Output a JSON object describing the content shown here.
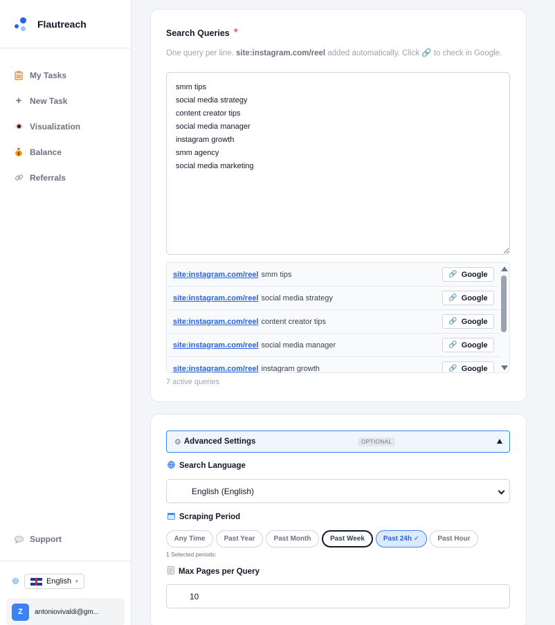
{
  "brand": {
    "name": "Flautreach"
  },
  "sidebar": {
    "items": [
      {
        "label": "My Tasks",
        "icon": "clipboard-icon"
      },
      {
        "label": "New Task",
        "icon": "plus-icon"
      },
      {
        "label": "Visualization",
        "icon": "eye-icon"
      },
      {
        "label": "Balance",
        "icon": "money-bag-icon"
      },
      {
        "label": "Referrals",
        "icon": "link-icon"
      }
    ],
    "support": "Support",
    "language": "English",
    "user": {
      "initial": "Z",
      "email": "antoniovivaldi@gm..."
    }
  },
  "queries": {
    "label": "Search Queries",
    "required": "*",
    "hint_pre": "One query per line.",
    "hint_prefix": "site:instagram.com/reel",
    "hint_mid": "added automatically. Click",
    "hint_post": "to check in Google.",
    "text": "smm tips\nsocial media strategy\ncontent creator tips\nsocial media manager\ninstagram growth\nsmm agency\nsocial media marketing",
    "rows": [
      {
        "prefix": "site:instagram.com/reel",
        "query": "smm tips",
        "button": "Google"
      },
      {
        "prefix": "site:instagram.com/reel",
        "query": "social media strategy",
        "button": "Google"
      },
      {
        "prefix": "site:instagram.com/reel",
        "query": "content creator tips",
        "button": "Google"
      },
      {
        "prefix": "site:instagram.com/reel",
        "query": "social media manager",
        "button": "Google"
      },
      {
        "prefix": "site:instagram.com/reel",
        "query": "instagram growth",
        "button": "Google"
      }
    ],
    "count_text": "7 active queries"
  },
  "advanced": {
    "title": "Advanced Settings",
    "badge": "OPTIONAL",
    "language_label": "Search Language",
    "language_value": "English (English)",
    "period_label": "Scraping Period",
    "periods": [
      "Any Time",
      "Past Year",
      "Past Month",
      "Past Week",
      "Past 24h ✓",
      "Past Hour"
    ],
    "selected_period": "Past 24h",
    "periods_note": "1 Selected periods:",
    "pages_label": "Max Pages per Query",
    "pages_value": "10"
  },
  "colors": {
    "accent": "#2563eb",
    "required": "#dc2626",
    "selected_bg": "#dbeafe"
  }
}
